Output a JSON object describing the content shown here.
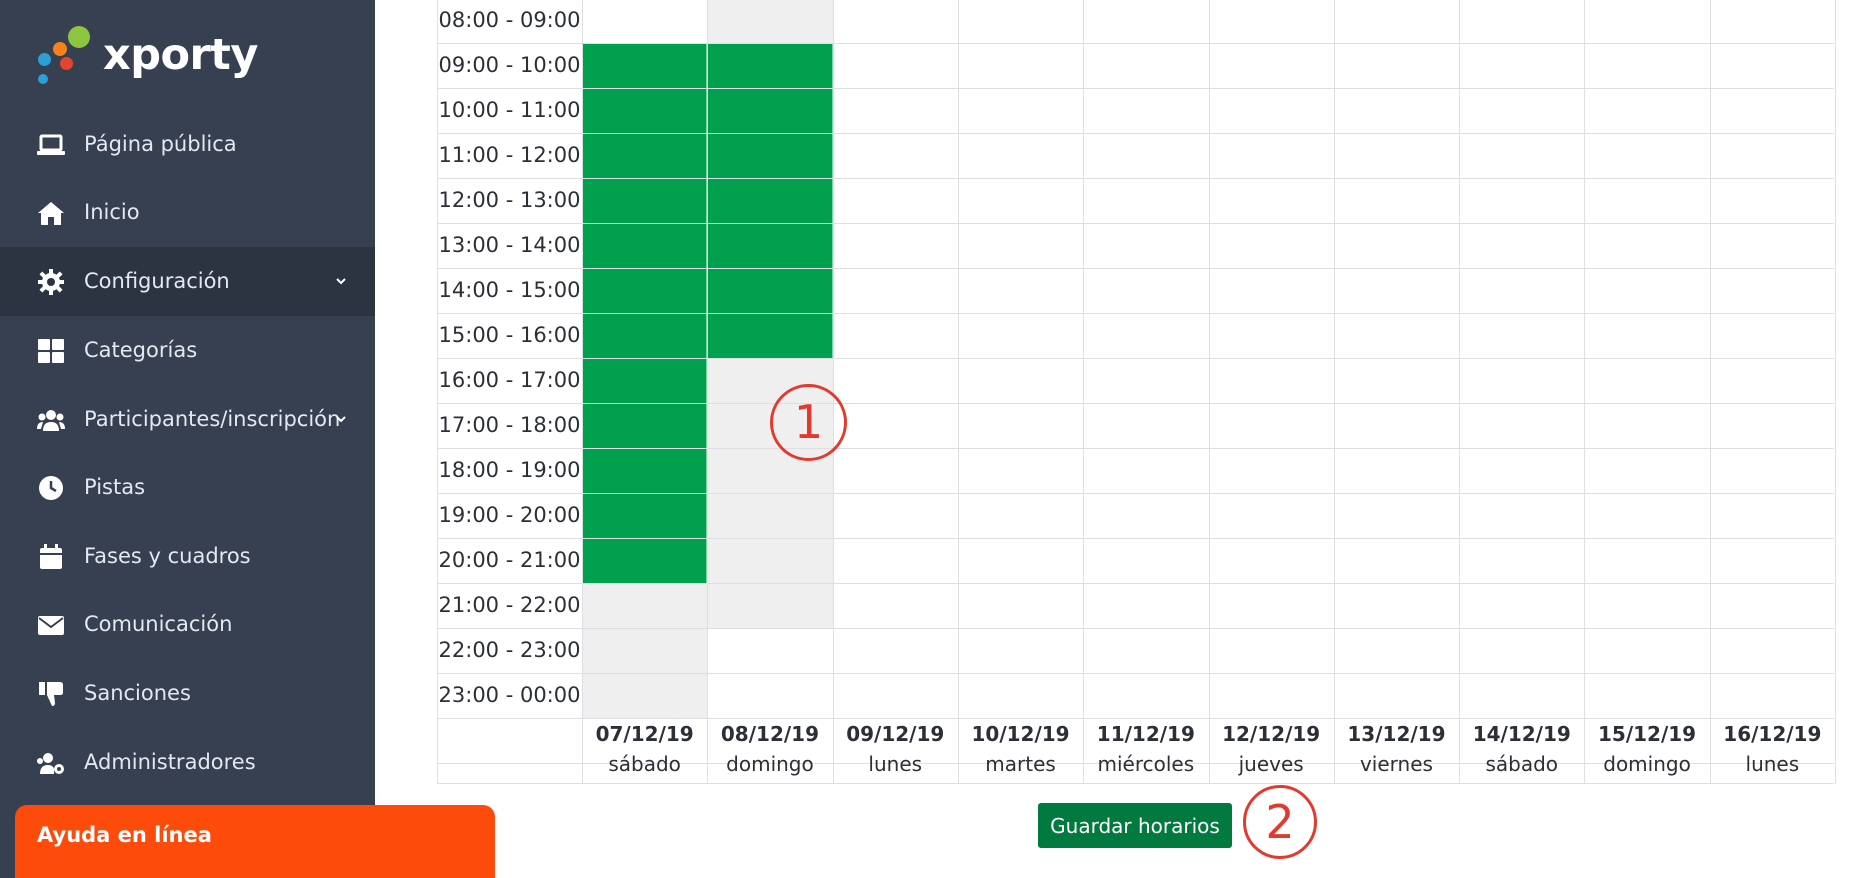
{
  "logo": {
    "text": "xporty"
  },
  "sidebar": {
    "items": [
      {
        "label": "Página pública",
        "icon": "laptop-icon"
      },
      {
        "label": "Inicio",
        "icon": "home-icon"
      },
      {
        "label": "Configuración",
        "icon": "gear-icon",
        "expandable": true,
        "active": true
      },
      {
        "label": "Categorías",
        "icon": "grid-icon"
      },
      {
        "label": "Participantes/inscripción",
        "icon": "users-icon",
        "expandable": true
      },
      {
        "label": "Pistas",
        "icon": "clock-icon"
      },
      {
        "label": "Fases y cuadros",
        "icon": "calendar-icon"
      },
      {
        "label": "Comunicación",
        "icon": "envelope-icon"
      },
      {
        "label": "Sanciones",
        "icon": "thumbs-down-icon"
      },
      {
        "label": "Administradores",
        "icon": "users-gear-icon"
      }
    ]
  },
  "help": {
    "label": "Ayuda en línea"
  },
  "schedule": {
    "time_slots": [
      "08:00 - 09:00",
      "09:00 - 10:00",
      "10:00 - 11:00",
      "11:00 - 12:00",
      "12:00 - 13:00",
      "13:00 - 14:00",
      "14:00 - 15:00",
      "15:00 - 16:00",
      "16:00 - 17:00",
      "17:00 - 18:00",
      "18:00 - 19:00",
      "19:00 - 20:00",
      "20:00 - 21:00",
      "21:00 - 22:00",
      "22:00 - 23:00",
      "23:00 - 00:00"
    ],
    "days": [
      {
        "date": "07/12/19",
        "weekday": "sábado"
      },
      {
        "date": "08/12/19",
        "weekday": "domingo"
      },
      {
        "date": "09/12/19",
        "weekday": "lunes"
      },
      {
        "date": "10/12/19",
        "weekday": "martes"
      },
      {
        "date": "11/12/19",
        "weekday": "miércoles"
      },
      {
        "date": "12/12/19",
        "weekday": "jueves"
      },
      {
        "date": "13/12/19",
        "weekday": "viernes"
      },
      {
        "date": "14/12/19",
        "weekday": "sábado"
      },
      {
        "date": "15/12/19",
        "weekday": "domingo"
      },
      {
        "date": "16/12/19",
        "weekday": "lunes"
      }
    ],
    "selected_color": "#01a04e",
    "unavailable_color": "#efefef",
    "selected_slots": {
      "07/12/19": [
        "09:00 - 10:00",
        "10:00 - 11:00",
        "11:00 - 12:00",
        "12:00 - 13:00",
        "13:00 - 14:00",
        "14:00 - 15:00",
        "15:00 - 16:00",
        "16:00 - 17:00",
        "17:00 - 18:00",
        "18:00 - 19:00",
        "19:00 - 20:00",
        "20:00 - 21:00"
      ],
      "08/12/19": [
        "09:00 - 10:00",
        "10:00 - 11:00",
        "11:00 - 12:00",
        "12:00 - 13:00",
        "13:00 - 14:00",
        "14:00 - 15:00",
        "15:00 - 16:00"
      ]
    },
    "unavailable_slots": {
      "07/12/19": [
        "21:00 - 22:00",
        "22:00 - 23:00",
        "23:00 - 00:00"
      ],
      "08/12/19": [
        "08:00 - 09:00",
        "16:00 - 17:00",
        "17:00 - 18:00",
        "18:00 - 19:00",
        "19:00 - 20:00",
        "20:00 - 21:00",
        "21:00 - 22:00"
      ]
    }
  },
  "save_button": {
    "label": "Guardar horarios"
  },
  "annotations": {
    "marker_1": "1",
    "marker_2": "2",
    "color": "#e13b30"
  }
}
